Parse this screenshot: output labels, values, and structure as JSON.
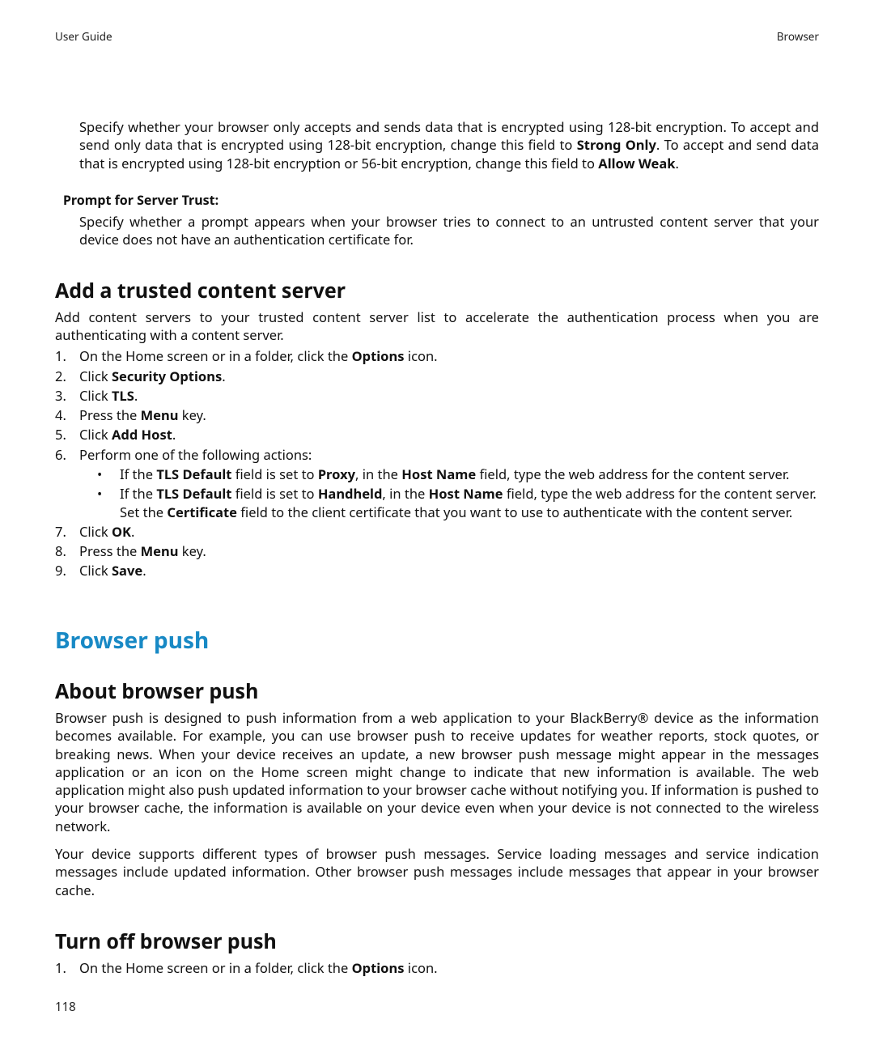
{
  "header": {
    "left": "User Guide",
    "right": "Browser"
  },
  "intro": {
    "p1_pre": "Specify whether your browser only accepts and sends data that is encrypted using 128-bit encryption. To accept and send only data that is encrypted using 128-bit encryption, change this field to ",
    "p1_b1": "Strong Only",
    "p1_mid": ". To accept and send data that is encrypted using 128-bit encryption or 56-bit encryption, change this field to ",
    "p1_b2": "Allow Weak",
    "p1_post": "."
  },
  "prompt": {
    "label": "Prompt for Server Trust:",
    "body": "Specify whether a prompt appears when your browser tries to connect to an untrusted content server that your device does not have an authentication certificate for."
  },
  "trusted": {
    "heading": "Add a trusted content server",
    "intro": "Add content servers to your trusted content server list to accelerate the authentication process when you are authenticating with a content server.",
    "steps": {
      "s1_pre": "On the Home screen or in a folder, click the ",
      "s1_b": "Options",
      "s1_post": " icon.",
      "s2_pre": "Click ",
      "s2_b": "Security Options",
      "s2_post": ".",
      "s3_pre": "Click ",
      "s3_b": "TLS",
      "s3_post": ".",
      "s4_pre": "Press the ",
      "s4_b": "Menu",
      "s4_post": " key.",
      "s5_pre": "Click ",
      "s5_b": "Add Host",
      "s5_post": ".",
      "s6": "Perform one of the following actions:",
      "b1_pre": "If the ",
      "b1_b1": "TLS Default",
      "b1_mid1": " field is set to ",
      "b1_b2": "Proxy",
      "b1_mid2": ", in the ",
      "b1_b3": "Host Name",
      "b1_post": " field, type the web address for the content server.",
      "b2_pre": "If the ",
      "b2_b1": "TLS Default",
      "b2_mid1": " field is set to ",
      "b2_b2": "Handheld",
      "b2_mid2": ", in the ",
      "b2_b3": "Host Name",
      "b2_mid3": " field, type the web address for the content server. Set the ",
      "b2_b4": "Certificate",
      "b2_post": " field to the client certificate that you want to use to authenticate with the content server.",
      "s7_pre": "Click ",
      "s7_b": "OK",
      "s7_post": ".",
      "s8_pre": "Press the ",
      "s8_b": "Menu",
      "s8_post": " key.",
      "s9_pre": "Click ",
      "s9_b": "Save",
      "s9_post": "."
    },
    "nums": {
      "n1": "1.",
      "n2": "2.",
      "n3": "3.",
      "n4": "4.",
      "n5": "5.",
      "n6": "6.",
      "n7": "7.",
      "n8": "8.",
      "n9": "9."
    }
  },
  "push": {
    "heading": "Browser push",
    "about_heading": "About browser push",
    "p1": "Browser push is designed to push information from a web application to your BlackBerry® device as the information becomes available. For example, you can use browser push to receive updates for weather reports, stock quotes, or breaking news. When your device receives an update, a new browser push message might appear in the messages application or an icon on the Home screen might change to indicate that new information is available. The web application might also push updated information to your browser cache without notifying you. If information is pushed to your browser cache, the information is available on your device even when your device is not connected to the wireless network.",
    "p2": "Your device supports different types of browser push messages. Service loading messages and service indication messages include updated information. Other browser push messages include messages that appear in your browser cache.",
    "turnoff_heading": "Turn off browser push",
    "to_s1_pre": "On the Home screen or in a folder, click the ",
    "to_s1_b": "Options",
    "to_s1_post": " icon.",
    "to_num1": "1."
  },
  "page_number": "118"
}
